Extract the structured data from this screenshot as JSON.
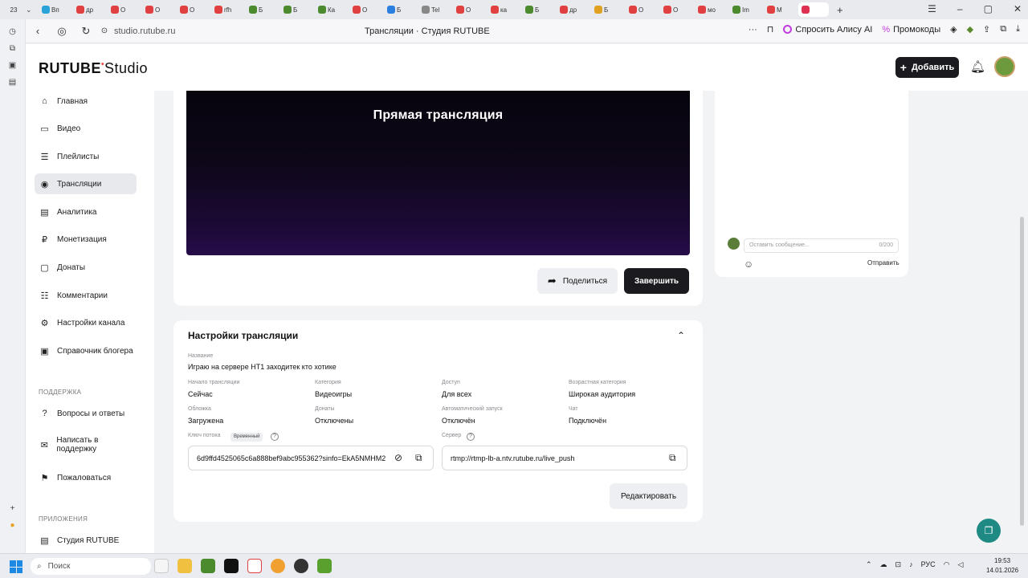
{
  "browser": {
    "tab_count": "23",
    "tabs": [
      {
        "label": "Вп",
        "color": "#2aa3d8"
      },
      {
        "label": "др",
        "color": "#e04040"
      },
      {
        "label": "О",
        "color": "#e04040"
      },
      {
        "label": "О",
        "color": "#e04040"
      },
      {
        "label": "О",
        "color": "#e04040"
      },
      {
        "label": "rfh",
        "color": "#e04040"
      },
      {
        "label": "Б",
        "color": "#4c8a2e"
      },
      {
        "label": "Б",
        "color": "#4c8a2e"
      },
      {
        "label": "Ка",
        "color": "#4c8a2e"
      },
      {
        "label": "О",
        "color": "#e04040"
      },
      {
        "label": "Б",
        "color": "#2a7fe0"
      },
      {
        "label": "Tel",
        "color": "#888888"
      },
      {
        "label": "О",
        "color": "#e04040"
      },
      {
        "label": "ка",
        "color": "#e04040"
      },
      {
        "label": "Б",
        "color": "#4c8a2e"
      },
      {
        "label": "др",
        "color": "#e04040"
      },
      {
        "label": "Б",
        "color": "#e0a020"
      },
      {
        "label": "О",
        "color": "#e04040"
      },
      {
        "label": "О",
        "color": "#e04040"
      },
      {
        "label": "мо",
        "color": "#e04040"
      },
      {
        "label": "Im",
        "color": "#4c8a2e"
      },
      {
        "label": "М",
        "color": "#e04040"
      },
      {
        "label": "",
        "color": "#e03050"
      }
    ],
    "url": "studio.rutube.ru",
    "page_title": "Трансляции · Студия RUTUBE",
    "alice_label": "Спросить Алису AI",
    "promo_label": "Промокоды"
  },
  "header": {
    "logo_text": "RUTUBE",
    "logo_suffix": "Studio",
    "add_label": "Добавить"
  },
  "sidebar": {
    "items": [
      {
        "label": "Главная",
        "icon": "home-icon",
        "glyph": "⌂"
      },
      {
        "label": "Видео",
        "icon": "video-icon",
        "glyph": "▭"
      },
      {
        "label": "Плейлисты",
        "icon": "playlist-icon",
        "glyph": "☰"
      },
      {
        "label": "Трансляции",
        "icon": "broadcast-icon",
        "glyph": "◉"
      },
      {
        "label": "Аналитика",
        "icon": "analytics-icon",
        "glyph": "▤"
      },
      {
        "label": "Монетизация",
        "icon": "monetization-icon",
        "glyph": "₽"
      },
      {
        "label": "Донаты",
        "icon": "donate-icon",
        "glyph": "▢"
      },
      {
        "label": "Комментарии",
        "icon": "comments-icon",
        "glyph": "☷"
      },
      {
        "label": "Настройки канала",
        "icon": "settings-icon",
        "glyph": "⚙"
      },
      {
        "label": "Справочник блогера",
        "icon": "handbook-icon",
        "glyph": "▣"
      }
    ],
    "support_heading": "ПОДДЕРЖКА",
    "support_items": [
      {
        "label": "Вопросы и ответы",
        "icon": "faq-icon",
        "glyph": "?"
      },
      {
        "label": "Написать в поддержку",
        "icon": "mail-icon",
        "glyph": "✉"
      },
      {
        "label": "Пожаловаться",
        "icon": "flag-icon",
        "glyph": "⚑"
      }
    ],
    "apps_heading": "ПРИЛОЖЕНИЯ",
    "apps_items": [
      {
        "label": "Студия RUTUBE",
        "icon": "studio-app-icon",
        "glyph": "▤"
      }
    ]
  },
  "player": {
    "title": "Прямая трансляция",
    "share_label": "Поделиться",
    "finish_label": "Завершить"
  },
  "settings": {
    "title": "Настройки трансляции",
    "name_label": "Название",
    "name_value": "Играю на сервере НТ1 заходитек кто хотике",
    "start_label": "Начало трансляции",
    "start_value": "Сейчас",
    "category_label": "Категория",
    "category_value": "Видеоигры",
    "access_label": "Доступ",
    "access_value": "Для всех",
    "age_label": "Возрастная категория",
    "age_value": "Широкая аудитория",
    "cover_label": "Обложка",
    "cover_value": "Загружена",
    "donations_label": "Донаты",
    "donations_value": "Отключены",
    "autostart_label": "Автоматический запуск",
    "autostart_value": "Отключён",
    "chat_label": "Чат",
    "chat_value": "Подключён",
    "key_label": "Ключ потока",
    "key_badge": "Временный",
    "key_value": "6d9ffd4525065c6a888bef9abc955362?sinfo=EkA5NMHM2",
    "server_label": "Сервер",
    "server_value": "rtmp://rtmp-lb-a.ntv.rutube.ru/live_push",
    "edit_label": "Редактировать"
  },
  "chat": {
    "placeholder": "Оставить сообщение...",
    "counter": "0/200",
    "send_label": "Отправить"
  },
  "taskbar": {
    "search_placeholder": "Поиск",
    "lang": "РУС",
    "time": "19:53",
    "date": "14.01.2026"
  }
}
